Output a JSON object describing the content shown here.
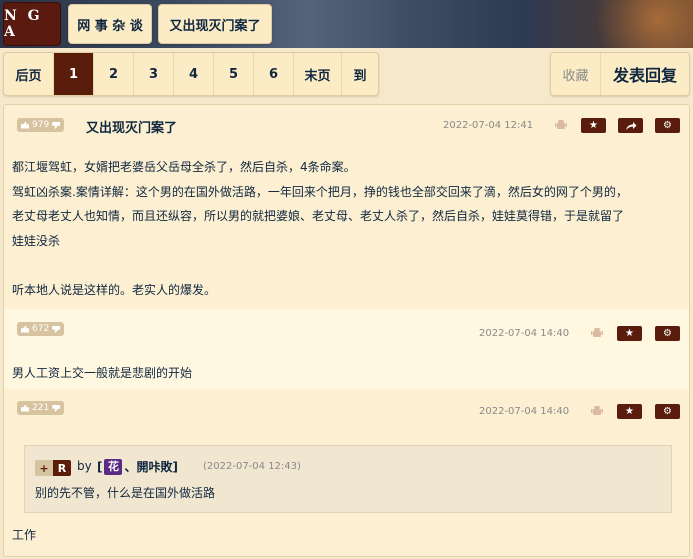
{
  "header": {
    "logo": "N G A",
    "breadcrumb": [
      "网 事 杂 谈",
      "又出现灭门案了"
    ]
  },
  "pagination": {
    "prev": "后页",
    "pages": [
      "1",
      "2",
      "3",
      "4",
      "5",
      "6"
    ],
    "current": "1",
    "last": "末页",
    "goto": "到"
  },
  "actions": {
    "favorite": "收藏",
    "reply": "发表回复"
  },
  "posts": [
    {
      "likes": "979",
      "title": "又出现灭门案了",
      "date": "2022-07-04 12:41",
      "content": [
        "都江堰驾虹，女婿把老婆岳父岳母全杀了，然后自杀，4条命案。",
        "驾虹凶杀案.案情详解：这个男的在国外做活路，一年回来个把月，挣的钱也全部交回来了滴，然后女的网了个男的，",
        "老丈母老丈人也知情，而且还纵容，所以男的就把婆娘、老丈母、老丈人杀了，然后自杀，娃娃莫得错，于是就留了",
        "娃娃没杀",
        "",
        "听本地人说是这样的。老实人的爆发。"
      ]
    },
    {
      "likes": "672",
      "date": "2022-07-04 14:40",
      "content": [
        "男人工资上交一般就是悲剧的开始"
      ]
    },
    {
      "likes": "221",
      "date": "2022-07-04 14:40",
      "quote": {
        "plus": "+",
        "badge": "R",
        "by": "by",
        "user_prefix": "[",
        "user_flower": "花",
        "user_name": "、開咔敗]",
        "date": "(2022-07-04 12:43)",
        "text": "别的先不管，什么是在国外做活路"
      },
      "content": [
        "工作"
      ]
    }
  ],
  "icons": {
    "like": "thumb-up-icon",
    "dislike": "thumb-down-icon",
    "client": "android-icon",
    "star": "star-icon",
    "share": "share-icon",
    "settings": "gear-icon"
  },
  "colors": {
    "accent": "#5a1d0c",
    "background": "#f5e8cb",
    "text": "#10273f",
    "muted": "#8a8a8a"
  }
}
